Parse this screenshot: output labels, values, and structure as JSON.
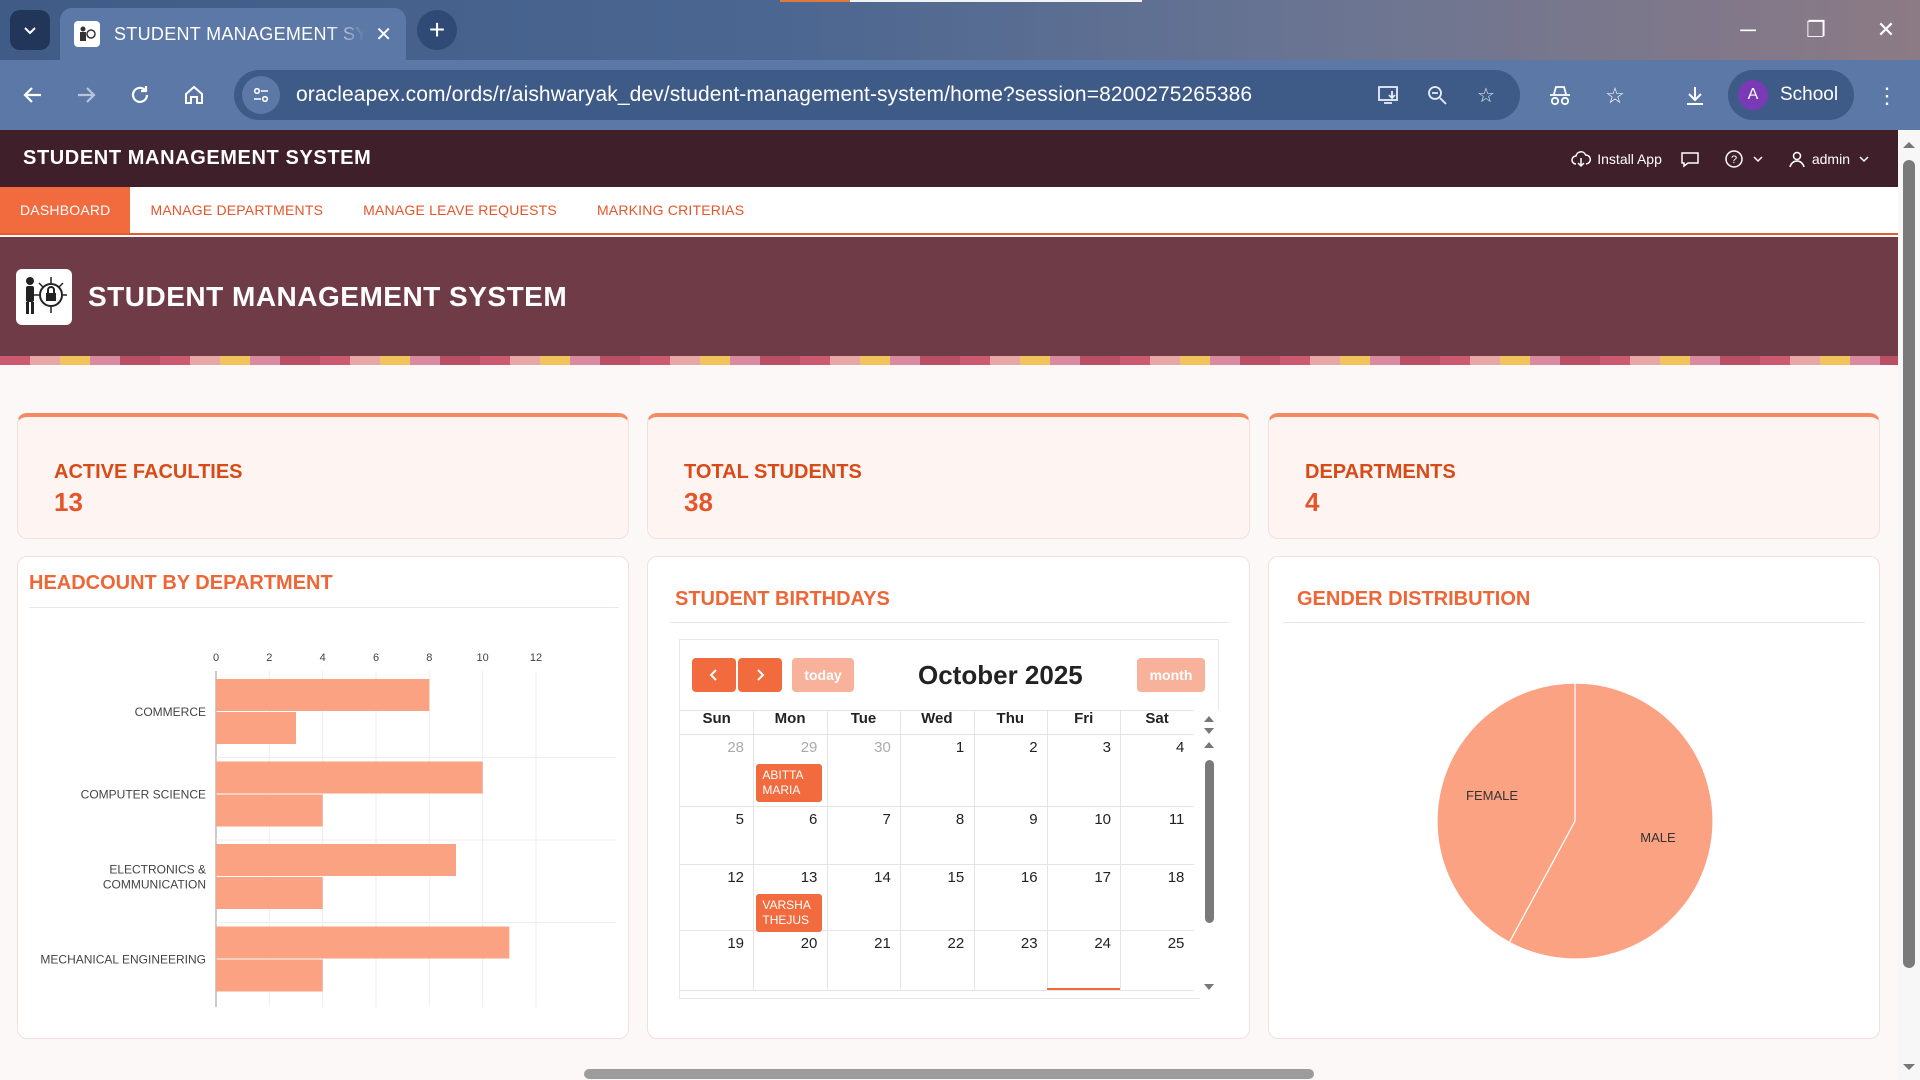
{
  "browser": {
    "tab_title": "STUDENT MANAGEMENT SYSTEM",
    "url": "oracleapex.com/ords/r/aishwaryak_dev/student-management-system/home?session=8200275265386",
    "profile_initial": "A",
    "profile_name": "School"
  },
  "app": {
    "brand": "STUDENT MANAGEMENT SYSTEM",
    "install_label": "Install App",
    "user_label": "admin",
    "nav": [
      "DASHBOARD",
      "MANAGE DEPARTMENTS",
      "MANAGE LEAVE REQUESTS",
      "MARKING CRITERIAS"
    ],
    "hero_title": "STUDENT MANAGEMENT SYSTEM"
  },
  "stats": [
    {
      "label": "ACTIVE FACULTIES",
      "value": "13"
    },
    {
      "label": "TOTAL STUDENTS",
      "value": "38"
    },
    {
      "label": "DEPARTMENTS",
      "value": "4"
    }
  ],
  "headcount": {
    "title": "HEADCOUNT BY DEPARTMENT"
  },
  "birthdays": {
    "title": "STUDENT BIRTHDAYS",
    "today_label": "today",
    "month_label": "month",
    "month_title": "October 2025",
    "weekdays": [
      "Sun",
      "Mon",
      "Tue",
      "Wed",
      "Thu",
      "Fri",
      "Sat"
    ],
    "weeks": [
      [
        "28",
        "29",
        "30",
        "1",
        "2",
        "3",
        "4"
      ],
      [
        "5",
        "6",
        "7",
        "8",
        "9",
        "10",
        "11"
      ],
      [
        "12",
        "13",
        "14",
        "15",
        "16",
        "17",
        "18"
      ],
      [
        "19",
        "20",
        "21",
        "22",
        "23",
        "24",
        "25"
      ]
    ],
    "events": [
      {
        "week": 0,
        "day": 1,
        "text": "ABITTA MARIA"
      },
      {
        "week": 2,
        "day": 1,
        "text": "VARSHA THEJUS"
      }
    ]
  },
  "gender": {
    "title": "GENDER DISTRIBUTION"
  },
  "colors": {
    "accent": "#f26b3e",
    "bar": "#fba283",
    "header": "#3f1f2a",
    "hero": "#6f3b47"
  },
  "chart_data": [
    {
      "type": "bar",
      "orientation": "horizontal",
      "categories": [
        "COMMERCE",
        "COMPUTER SCIENCE",
        "ELECTRONICS & COMMUNICATION",
        "MECHANICAL ENGINEERING"
      ],
      "series": [
        {
          "values": [
            8,
            10,
            9,
            11
          ]
        },
        {
          "values": [
            3,
            4,
            4,
            4
          ]
        }
      ],
      "xlim": [
        0,
        12
      ],
      "xticks": [
        "0",
        "2",
        "4",
        "6",
        "8",
        "10",
        "12"
      ],
      "axis_position": "top",
      "grid": true
    },
    {
      "type": "pie",
      "labels": [
        "MALE",
        "FEMALE"
      ],
      "values": [
        22,
        16
      ]
    }
  ]
}
